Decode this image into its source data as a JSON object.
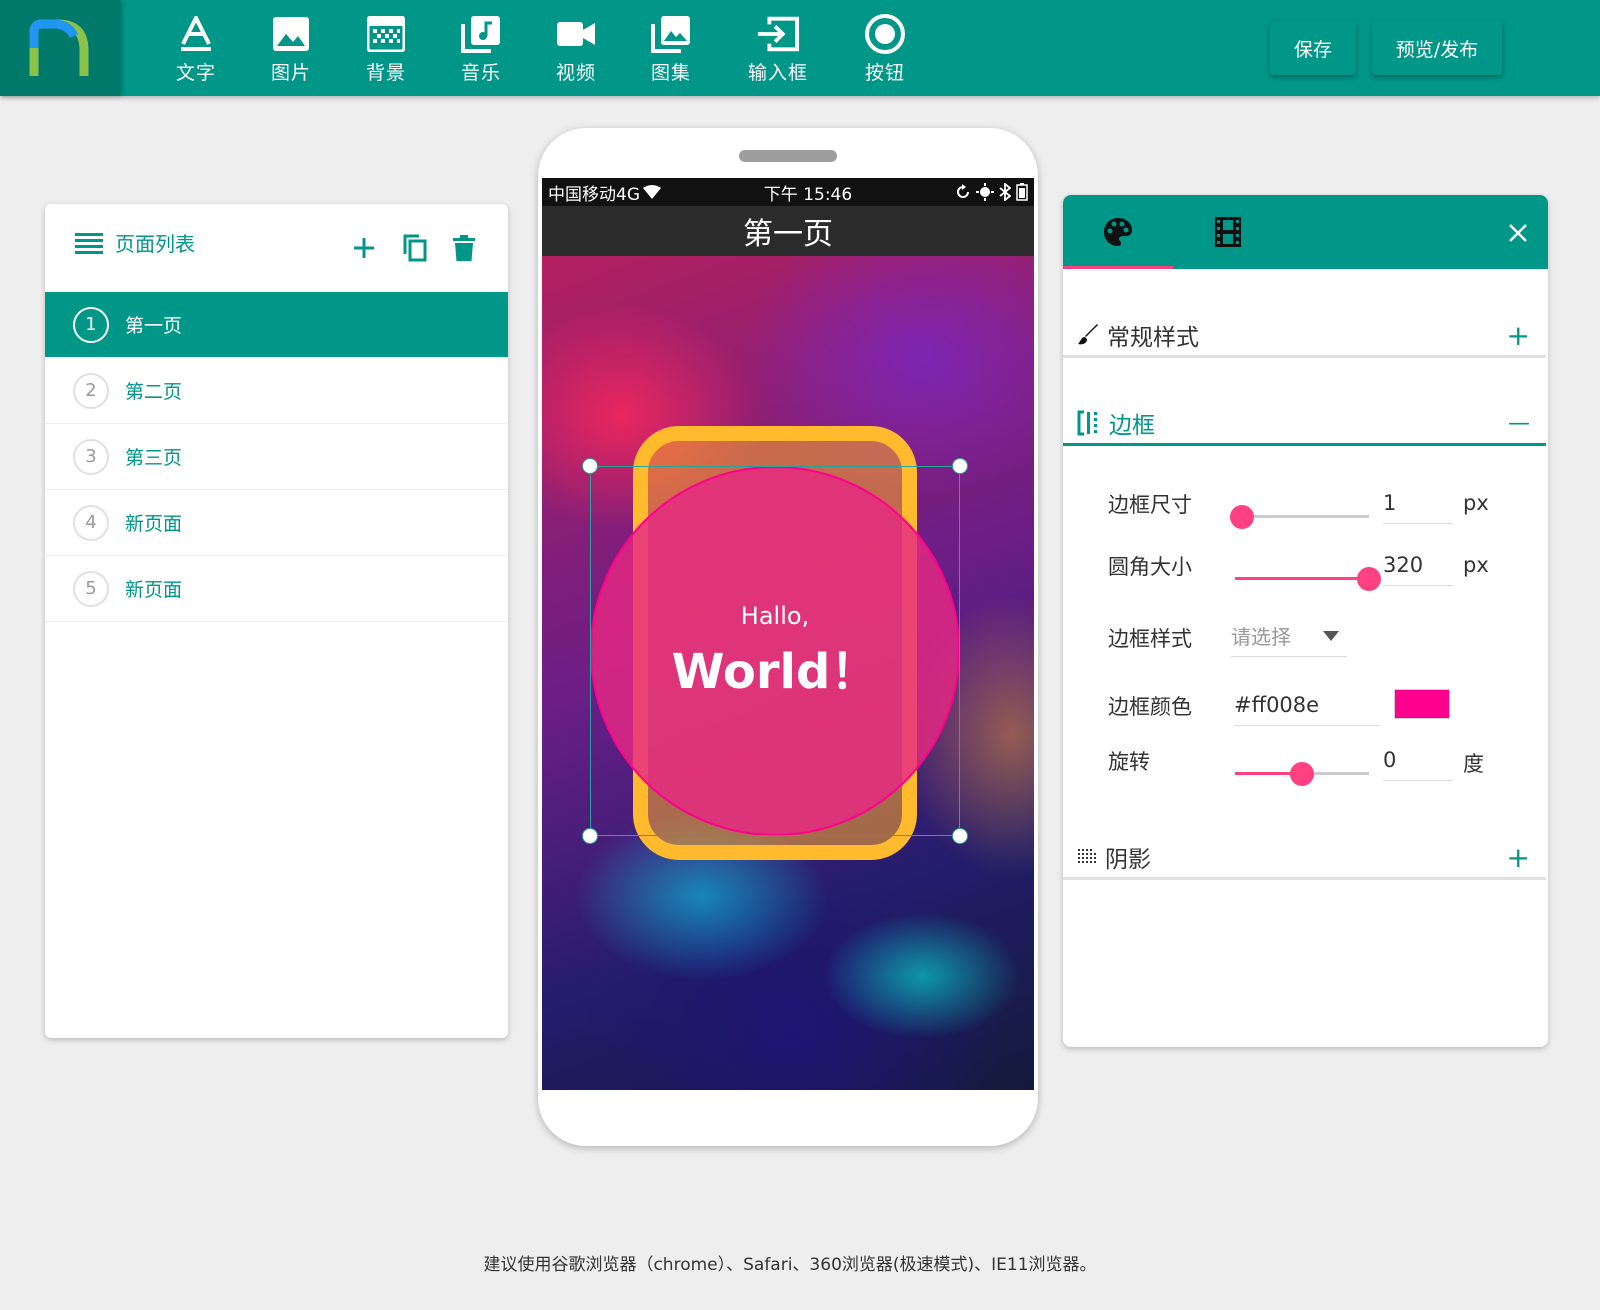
{
  "toolbar": {
    "items": [
      {
        "label": "文字",
        "icon": "text-icon"
      },
      {
        "label": "图片",
        "icon": "image-icon"
      },
      {
        "label": "背景",
        "icon": "background-icon"
      },
      {
        "label": "音乐",
        "icon": "music-icon"
      },
      {
        "label": "视频",
        "icon": "video-icon"
      },
      {
        "label": "图集",
        "icon": "gallery-icon"
      },
      {
        "label": "输入框",
        "icon": "input-icon"
      },
      {
        "label": "按钮",
        "icon": "button-icon"
      }
    ],
    "save_label": "保存",
    "publish_label": "预览/发布"
  },
  "page_list": {
    "title": "页面列表",
    "pages": [
      {
        "num": "1",
        "name": "第一页",
        "active": true
      },
      {
        "num": "2",
        "name": "第二页",
        "active": false
      },
      {
        "num": "3",
        "name": "第三页",
        "active": false
      },
      {
        "num": "4",
        "name": "新页面",
        "active": false
      },
      {
        "num": "5",
        "name": "新页面",
        "active": false
      }
    ]
  },
  "phone": {
    "carrier": "中国移动4G",
    "time": "下午 15:46",
    "page_title": "第一页",
    "hello_small": "Hallo,",
    "hello_big": "World！"
  },
  "style_panel": {
    "sections": {
      "general": {
        "title": "常规样式",
        "toggle": "+"
      },
      "border": {
        "title": "边框",
        "toggle": "—"
      },
      "shadow": {
        "title": "阴影",
        "toggle": "+"
      }
    },
    "border": {
      "size_label": "边框尺寸",
      "size_value": "1",
      "size_unit": "px",
      "size_fraction": 0.05,
      "radius_label": "圆角大小",
      "radius_value": "320",
      "radius_unit": "px",
      "radius_fraction": 1.0,
      "style_label": "边框样式",
      "style_placeholder": "请选择",
      "color_label": "边框颜色",
      "color_value": "#ff008e",
      "rotate_label": "旋转",
      "rotate_value": "0",
      "rotate_unit": "度",
      "rotate_fraction": 0.5
    }
  },
  "footer": {
    "note": "建议使用谷歌浏览器（chrome）、Safari、360浏览器(极速模式)、IE11浏览器。"
  },
  "colors": {
    "primary": "#009688",
    "primary_dark": "#00796b",
    "accent": "#ff4081",
    "border_swatch": "#ff008e",
    "yellow": "#ffba2e"
  }
}
